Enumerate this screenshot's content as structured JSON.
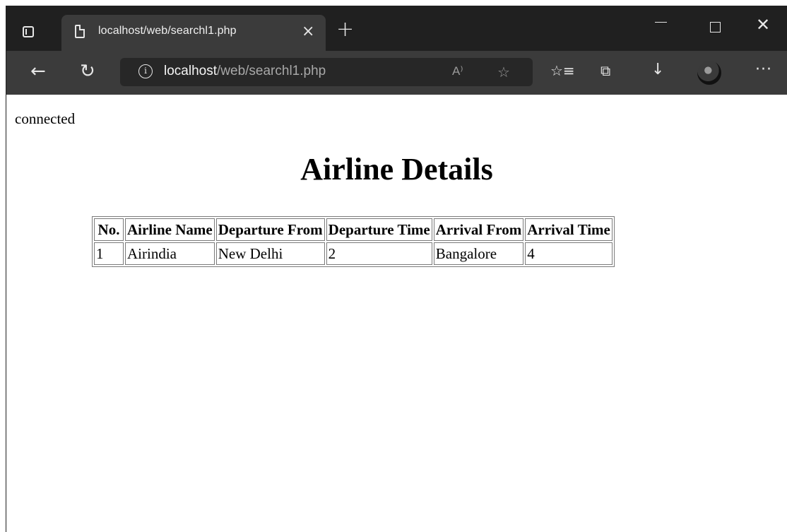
{
  "browser": {
    "tab_title": "localhost/web/searchl1.php",
    "tab_close": "×",
    "new_tab": "+",
    "url_host": "localhost",
    "url_path": "/web/searchl1.php",
    "read_aloud": "A⁾",
    "more": "···",
    "icons": [
      "tab-actions-icon",
      "page-icon",
      "close-icon",
      "plus-icon",
      "minimize-icon",
      "maximize-icon",
      "close-window-icon",
      "back-icon",
      "reload-icon",
      "info-icon",
      "read-aloud-icon",
      "add-favorite-icon",
      "favorites-icon",
      "collections-icon",
      "download-icon",
      "profile-avatar",
      "more-icon"
    ]
  },
  "page": {
    "status": "connected",
    "title": "Airline Details",
    "table": {
      "headers": [
        "No.",
        "Airline Name",
        "Departure From",
        "Departure Time",
        "Arrival From",
        "Arrival Time"
      ],
      "rows": [
        [
          "1",
          "Airindia",
          "New Delhi",
          "2",
          "Bangalore",
          "4"
        ]
      ]
    }
  }
}
